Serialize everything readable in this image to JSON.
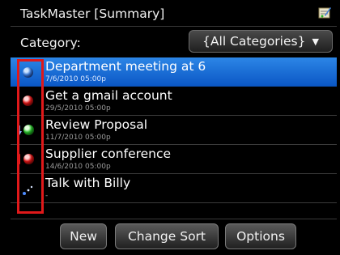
{
  "window": {
    "title": "TaskMaster [Summary]",
    "app_icon": "taskmaster-app-icon"
  },
  "category": {
    "label": "Category:",
    "selected": "{All Categories}",
    "arrow": "▼"
  },
  "tasks": [
    {
      "title": "Department meeting at 6",
      "date": "7/6/2010 05:00p",
      "status_icon": "blue-ball",
      "priority_icon": null,
      "selected": true
    },
    {
      "title": "Get a gmail account",
      "date": "29/5/2010 05:00p",
      "status_icon": "red-ball",
      "priority_icon": null,
      "selected": false
    },
    {
      "title": "Review Proposal",
      "date": "11/7/2010 05:00p",
      "status_icon": "green-ball",
      "priority_icon": "low-priority-arrow",
      "selected": false
    },
    {
      "title": "Supplier conference",
      "date": "14/6/2010 05:00p",
      "status_icon": "red-ball",
      "priority_icon": "high-priority-bar",
      "selected": false
    },
    {
      "title": "Talk with Billy",
      "date": "-",
      "status_icon": "dots",
      "priority_icon": null,
      "selected": false
    }
  ],
  "buttons": {
    "new": "New",
    "change_sort": "Change Sort",
    "options": "Options"
  },
  "colors": {
    "selection": "#1a6fd8",
    "highlight_box": "#e0191a",
    "background": "#000000"
  }
}
